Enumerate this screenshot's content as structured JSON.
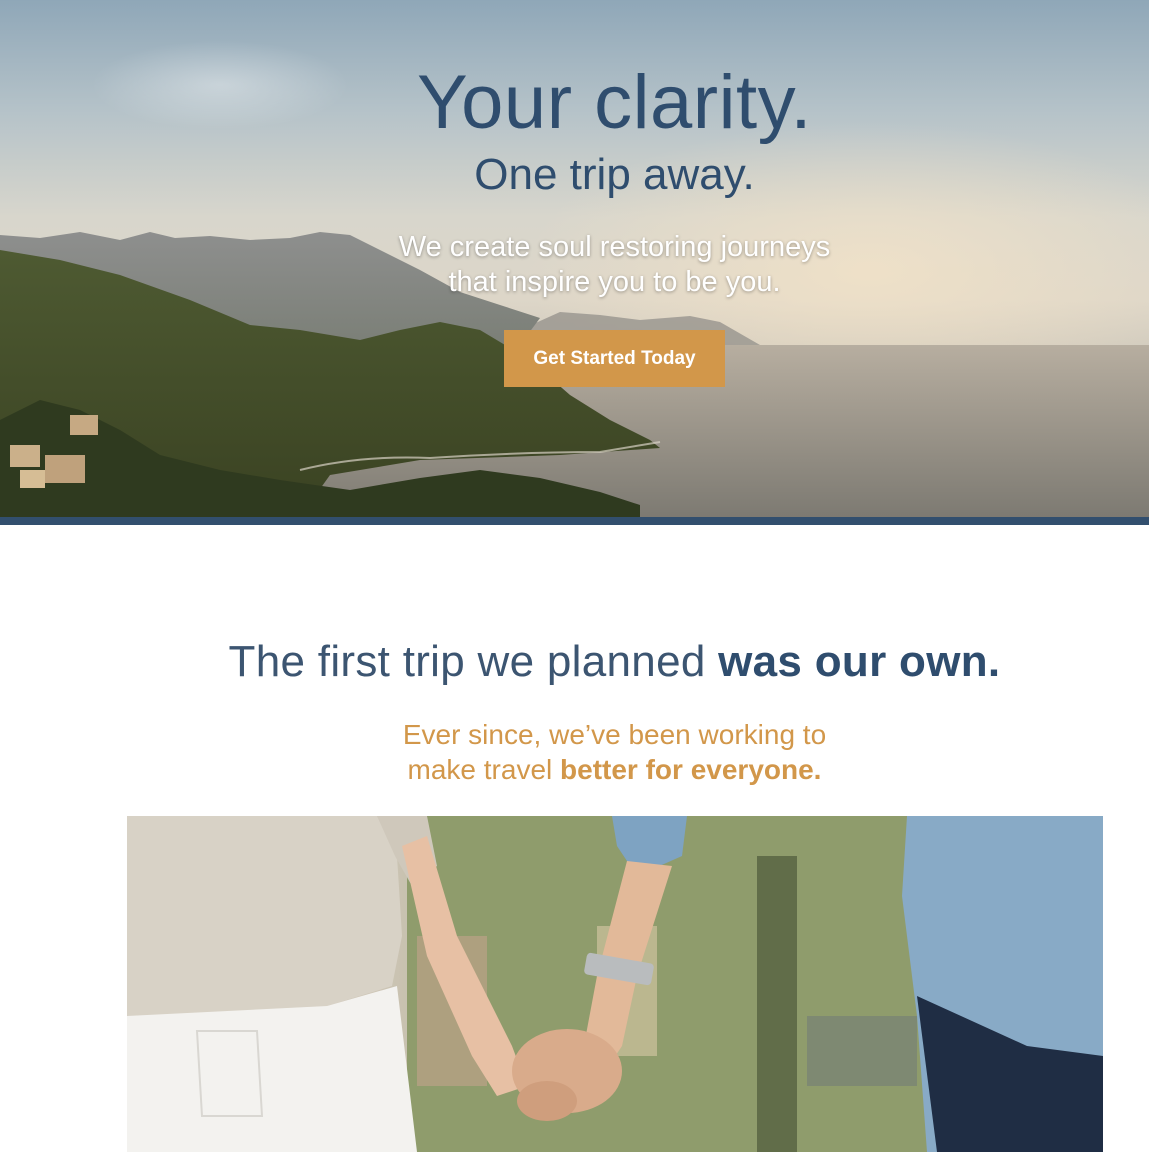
{
  "hero": {
    "title": "Your clarity.",
    "subtitle": "One trip away.",
    "tagline_line1": "We create soul restoring journeys",
    "tagline_line2": "that inspire you to be you.",
    "cta_label": "Get Started Today",
    "accent_color": "#d2974a",
    "title_color": "#2f4d6e",
    "bar_color": "#324f6e"
  },
  "story": {
    "heading_light": "The first trip we planned",
    "heading_bold": "was our own.",
    "sub_line1": "Ever since, we’ve been working to",
    "sub_line2_light": "make travel",
    "sub_line2_bold": "better for everyone."
  }
}
